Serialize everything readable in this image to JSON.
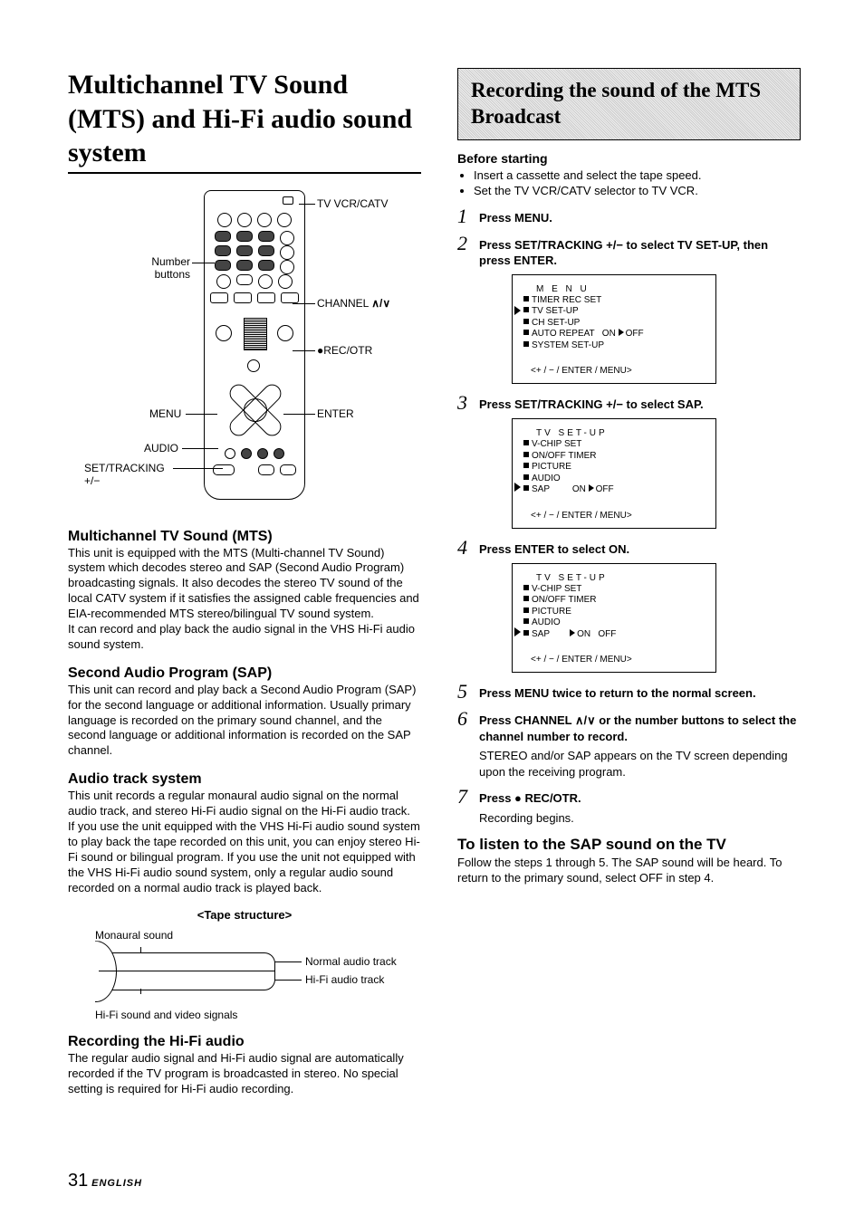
{
  "page_number": "31",
  "language_label": "ENGLISH",
  "title": "Multichannel TV Sound (MTS) and Hi-Fi audio sound system",
  "remote_labels": {
    "number_buttons": "Number\nbuttons",
    "menu": "MENU",
    "audio": "AUDIO",
    "set_tracking": "SET/TRACKING\n+/−",
    "tv_vcr_catv": "TV VCR/CATV",
    "channel": "CHANNEL ",
    "channel_arrows": "∧/∨",
    "rec_otr": "●REC/OTR",
    "enter": "ENTER"
  },
  "sections": {
    "mts": {
      "heading": "Multichannel TV Sound (MTS)",
      "body": "This unit is equipped with the MTS (Multi-channel TV Sound) system which decodes stereo and SAP (Second Audio Program) broadcasting signals. It also decodes the stereo TV sound of the local CATV system if it satisfies the assigned cable frequencies and EIA-recommended MTS stereo/bilingual TV sound system.\nIt can record and play back the audio signal in the VHS Hi-Fi audio sound system."
    },
    "sap": {
      "heading": "Second Audio Program (SAP)",
      "body": "This unit can record and play back a Second Audio Program (SAP) for the second language or additional information. Usually primary language is recorded on the primary sound channel, and the second language or additional information is recorded on the SAP channel."
    },
    "audio_track": {
      "heading": "Audio track system",
      "body": "This unit records a regular monaural audio signal on the normal audio track, and stereo Hi-Fi audio signal on the Hi-Fi audio track.\nIf you use the unit equipped with the VHS Hi-Fi audio sound system to play back the tape recorded on this unit, you can enjoy stereo Hi-Fi sound or bilingual program. If you use the unit not equipped with the VHS Hi-Fi audio sound system, only a regular audio sound recorded on a normal audio track is played back."
    },
    "tape": {
      "caption": "<Tape structure>",
      "monaural": "Monaural sound",
      "normal": "Normal audio track",
      "hifi": "Hi-Fi audio track",
      "hifi_signals": "Hi-Fi sound and video signals"
    },
    "rec_hifi": {
      "heading": "Recording the Hi-Fi audio",
      "body": "The regular audio signal and Hi-Fi audio signal are automatically recorded if the TV program is broadcasted in stereo. No special setting is required for Hi-Fi audio recording."
    }
  },
  "right": {
    "banner": "Recording the sound of the MTS Broadcast",
    "before_heading": "Before starting",
    "before_bullets": [
      "Insert a cassette and select the tape speed.",
      "Set the TV VCR/CATV selector to TV VCR."
    ],
    "steps": {
      "s1": {
        "num": "1",
        "bold": "Press MENU."
      },
      "s2": {
        "num": "2",
        "bold": "Press SET/TRACKING +/− to select TV SET-UP, then press ENTER."
      },
      "s3": {
        "num": "3",
        "bold": "Press SET/TRACKING +/− to select SAP."
      },
      "s4": {
        "num": "4",
        "bold": "Press ENTER to select ON."
      },
      "s5": {
        "num": "5",
        "bold": "Press MENU twice to return to the normal screen."
      },
      "s6": {
        "num": "6",
        "bold": "Press CHANNEL ∧/∨ or the number buttons to select the channel number to record.",
        "sub": "STEREO and/or SAP appears on the TV screen depending upon the receiving program."
      },
      "s7": {
        "num": "7",
        "bold": "Press ● REC/OTR.",
        "sub": "Recording begins."
      }
    },
    "screen1": {
      "title": "M E N U",
      "lines": [
        "TIMER REC SET",
        "TV SET-UP",
        "CH SET-UP",
        "AUTO REPEAT   ON ▶OFF",
        "SYSTEM SET-UP"
      ],
      "nav": "<+ / − / ENTER / MENU>",
      "cursor_index": 1
    },
    "screen2": {
      "title": "TV SET-UP",
      "lines": [
        "V-CHIP SET",
        "ON/OFF TIMER",
        "PICTURE",
        "AUDIO",
        "SAP         ON ▶OFF"
      ],
      "nav": "<+ / − / ENTER / MENU>",
      "cursor_index": 4
    },
    "screen3": {
      "title": "TV SET-UP",
      "lines": [
        "V-CHIP SET",
        "ON/OFF TIMER",
        "PICTURE",
        "AUDIO",
        "SAP        ▶ON   OFF"
      ],
      "nav": "<+ / − / ENTER / MENU>",
      "cursor_index": 4
    },
    "listen": {
      "heading": "To listen to the SAP sound on the TV",
      "body": "Follow the steps 1 through 5. The SAP sound will be heard. To return to the primary sound, select OFF in step 4."
    }
  }
}
